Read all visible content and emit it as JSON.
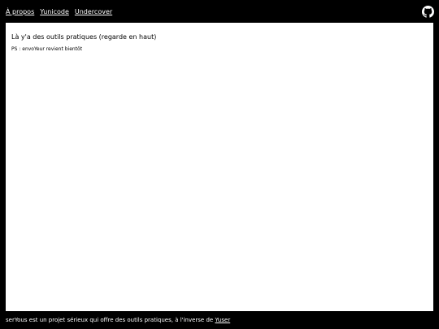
{
  "nav": {
    "links": [
      {
        "label": "À propos"
      },
      {
        "label": "Yunicode"
      },
      {
        "label": "Undercover"
      }
    ],
    "github_icon": "github-icon"
  },
  "main": {
    "heading": "Là y'a des outils pratiques (regarde en haut)",
    "note": "PS : envoYeur revient bientôt"
  },
  "footer": {
    "text": "serYous est un projet sérieux qui offre des outils pratiques, à l'inverse de ",
    "link_label": "Yuser"
  },
  "colors": {
    "background": "#000000",
    "panel": "#ffffff",
    "text_light": "#ffffff",
    "text_dark": "#000000"
  }
}
